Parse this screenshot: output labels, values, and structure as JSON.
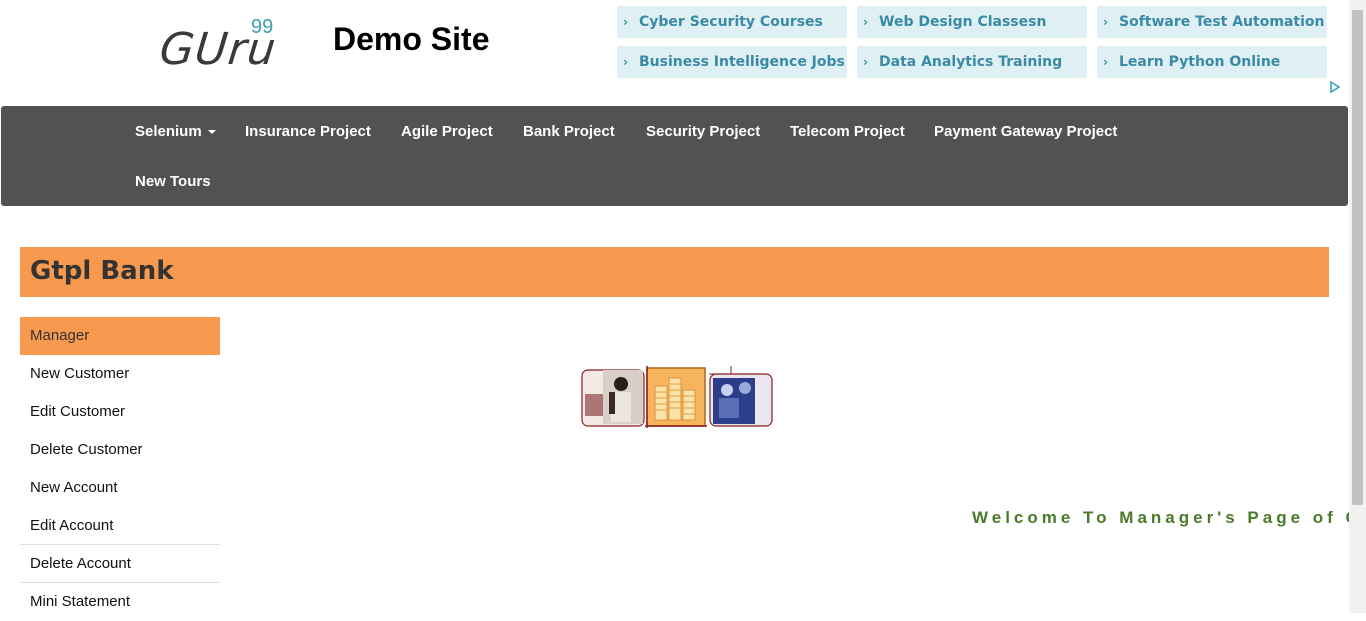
{
  "header": {
    "logo_text": "GUru",
    "logo_sup": "99",
    "site_title": "Demo Site"
  },
  "ads": [
    {
      "label": "Cyber Security Courses"
    },
    {
      "label": "Web Design Classesn"
    },
    {
      "label": "Software Test Automation"
    },
    {
      "label": "Business Intelligence Jobs"
    },
    {
      "label": "Data Analytics Training"
    },
    {
      "label": "Learn Python Online"
    }
  ],
  "nav": {
    "items": [
      {
        "label": "Selenium"
      },
      {
        "label": "Insurance Project"
      },
      {
        "label": "Agile Project"
      },
      {
        "label": "Bank Project"
      },
      {
        "label": "Security Project"
      },
      {
        "label": "Telecom Project"
      },
      {
        "label": "Payment Gateway Project"
      },
      {
        "label": "New Tours"
      }
    ]
  },
  "bank": {
    "title": "Gtpl Bank"
  },
  "menu": {
    "items": [
      {
        "label": "Manager"
      },
      {
        "label": "New Customer"
      },
      {
        "label": "Edit Customer"
      },
      {
        "label": "Delete Customer"
      },
      {
        "label": "New Account"
      },
      {
        "label": "Edit Account"
      },
      {
        "label": "Delete Account"
      },
      {
        "label": "Mini Statement"
      }
    ]
  },
  "main": {
    "welcome": "Welcome To Manager's Page of G"
  },
  "colors": {
    "accent_orange": "#f79a4f",
    "navbar_bg": "#525252",
    "ad_bg": "#dff0f5",
    "ad_text": "#3a8aa5",
    "welcome_text": "#4a7a2a"
  }
}
